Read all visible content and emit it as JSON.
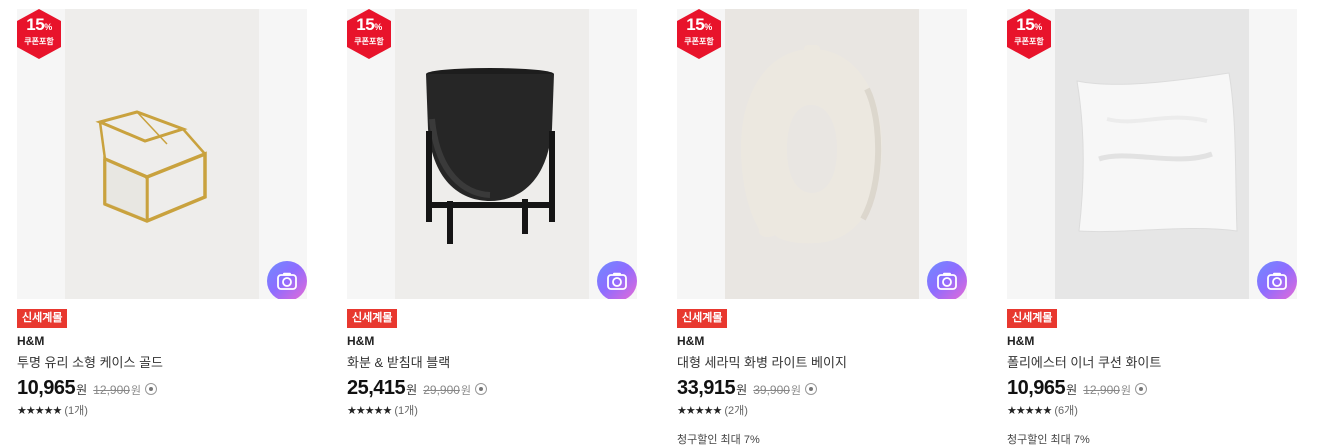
{
  "products": [
    {
      "badge_percent": "15",
      "badge_percent_unit": "%",
      "badge_label": "쿠폰포함",
      "tag": "신세계몰",
      "brand": "H&M",
      "name": "투명 유리 소형 케이스 골드",
      "price": "10,965",
      "price_unit": "원",
      "original_price": "12,900",
      "original_unit": "원",
      "stars": "★★★★★",
      "review_count": "(1개)",
      "promo": "",
      "image_icon": "glass-box-image"
    },
    {
      "badge_percent": "15",
      "badge_percent_unit": "%",
      "badge_label": "쿠폰포함",
      "tag": "신세계몰",
      "brand": "H&M",
      "name": "화분 & 받침대 블랙",
      "price": "25,415",
      "price_unit": "원",
      "original_price": "29,900",
      "original_unit": "원",
      "stars": "★★★★★",
      "review_count": "(1개)",
      "promo": "",
      "image_icon": "plant-pot-image"
    },
    {
      "badge_percent": "15",
      "badge_percent_unit": "%",
      "badge_label": "쿠폰포함",
      "tag": "신세계몰",
      "brand": "H&M",
      "name": "대형 세라믹 화병 라이트 베이지",
      "price": "33,915",
      "price_unit": "원",
      "original_price": "39,900",
      "original_unit": "원",
      "stars": "★★★★★",
      "review_count": "(2개)",
      "promo": "청구할인 최대 7%",
      "image_icon": "ring-vase-image"
    },
    {
      "badge_percent": "15",
      "badge_percent_unit": "%",
      "badge_label": "쿠폰포함",
      "tag": "신세계몰",
      "brand": "H&M",
      "name": "폴리에스터 이너 쿠션 화이트",
      "price": "10,965",
      "price_unit": "원",
      "original_price": "12,900",
      "original_unit": "원",
      "stars": "★★★★★",
      "review_count": "(6개)",
      "promo": "청구할인 최대 7%",
      "image_icon": "cushion-image"
    }
  ],
  "colors": {
    "badge_red": "#e8132b",
    "tag_red": "#e8382f",
    "camera_gradient": [
      "#6f8cff",
      "#8d6cff",
      "#e86cd6"
    ]
  }
}
